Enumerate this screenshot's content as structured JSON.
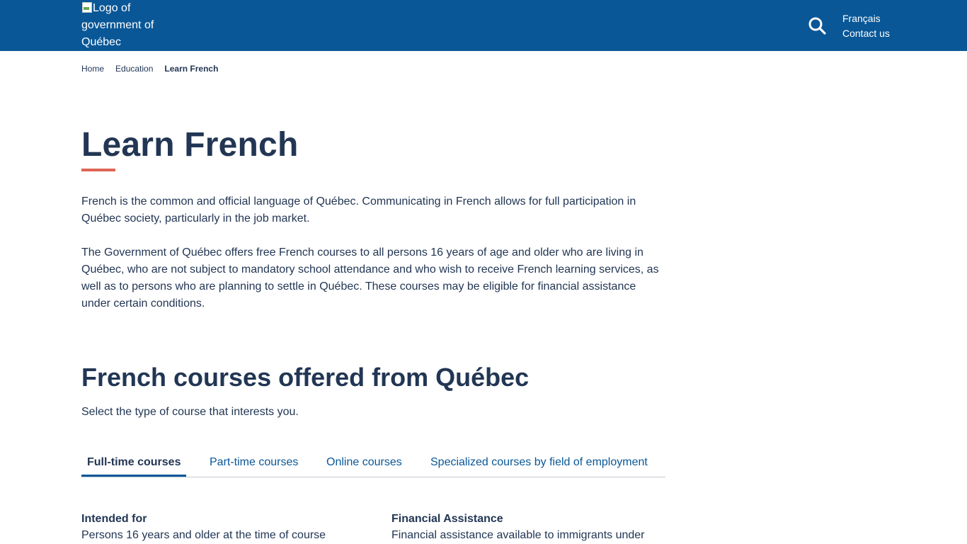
{
  "header": {
    "logo_alt": "Logo of government of Québec",
    "lang_link": "Français",
    "contact_link": "Contact us",
    "search_icon": "search-icon",
    "color": "#095797"
  },
  "breadcrumb": {
    "items": [
      "Home",
      "Education"
    ],
    "current": "Learn French"
  },
  "page": {
    "title": "Learn French",
    "accent_color": "#df6555",
    "intro_1": "French is the common and official language of Québec. Communicating in French allows for full participation in Québec society, particularly in the job market.",
    "intro_2": "The Government of Québec offers free French courses to all persons 16 years of age and older who are living in Québec, who are not subject to mandatory school attendance and who wish to receive French learning services, as well as to persons who are planning to settle in Québec. These courses may be eligible for financial assistance under certain conditions."
  },
  "courses": {
    "title": "French courses offered from Québec",
    "subtitle": "Select the type of course that interests you.",
    "tabs": [
      {
        "label": "Full-time courses",
        "active": true
      },
      {
        "label": "Part-time courses",
        "active": false
      },
      {
        "label": "Online courses",
        "active": false
      },
      {
        "label": "Specialized courses by field of employment",
        "active": false
      }
    ],
    "intended_for": {
      "heading": "Intended for",
      "text": "Persons 16 years and older at the time of course"
    },
    "financial": {
      "heading": "Financial Assistance",
      "text": "Financial assistance available to immigrants under"
    }
  }
}
